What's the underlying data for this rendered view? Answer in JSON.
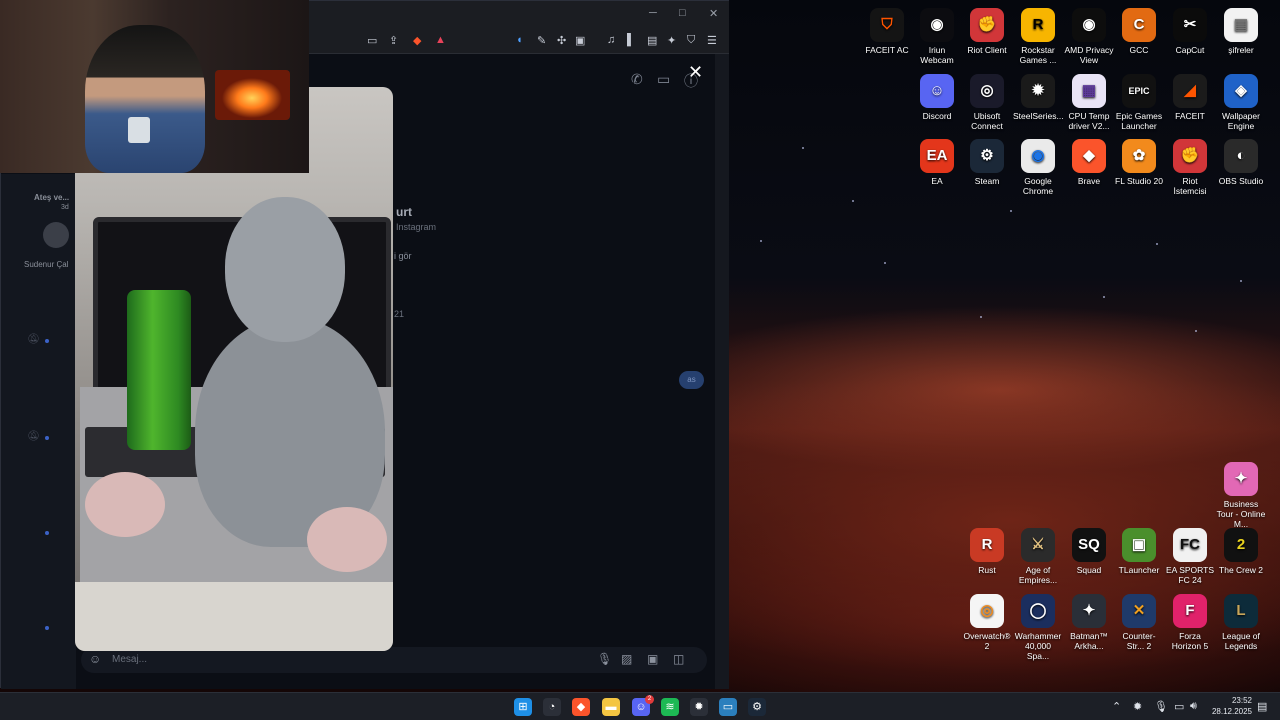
{
  "desktop": {
    "icons": [
      {
        "label": "FACEIT AC",
        "glyph": "⛉",
        "color": "#141414",
        "fg": "#ff5500"
      },
      {
        "label": "Iriun Webcam",
        "glyph": "◉",
        "color": "#0c0c10",
        "fg": "#ffffff"
      },
      {
        "label": "Riot Client",
        "glyph": "✊",
        "color": "#d13639",
        "fg": "#ffffff"
      },
      {
        "label": "Rockstar Games ...",
        "glyph": "R",
        "color": "#f7b500",
        "fg": "#000000"
      },
      {
        "label": "AMD Privacy View",
        "glyph": "◉",
        "color": "#0d0d0d",
        "fg": "#ffffff"
      },
      {
        "label": "GCC",
        "glyph": "C",
        "color": "#e26a12",
        "fg": "#ffffff"
      },
      {
        "label": "CapCut",
        "glyph": "✂",
        "color": "#0b0b0b",
        "fg": "#ffffff"
      },
      {
        "label": "şifreler",
        "glyph": "▤",
        "color": "#f2f2f2",
        "fg": "#777777"
      },
      {
        "label": "Discord",
        "glyph": "☺",
        "color": "#5865f2",
        "fg": "#ffffff"
      },
      {
        "label": "Ubisoft Connect",
        "glyph": "◎",
        "color": "#1a1a2a",
        "fg": "#ffffff"
      },
      {
        "label": "SteelSeries...",
        "glyph": "✹",
        "color": "#1a1a1a",
        "fg": "#ffffff"
      },
      {
        "label": "CPU Temp driver V2...",
        "glyph": "▦",
        "color": "#e9e4f6",
        "fg": "#5d3a9b"
      },
      {
        "label": "Epic Games Launcher",
        "glyph": "EPIC",
        "color": "#111111",
        "fg": "#ffffff"
      },
      {
        "label": "FACEIT",
        "glyph": "◢",
        "color": "#1b1b1b",
        "fg": "#ff5500"
      },
      {
        "label": "Wallpaper Engine",
        "glyph": "◈",
        "color": "#1f62c8",
        "fg": "#ffffff"
      },
      {
        "label": "EA",
        "glyph": "EA",
        "color": "#e3361b",
        "fg": "#ffffff"
      },
      {
        "label": "Steam",
        "glyph": "⚙",
        "color": "#1b2838",
        "fg": "#ffffff"
      },
      {
        "label": "Google Chrome",
        "glyph": "◉",
        "color": "#eaeaea",
        "fg": "#1a73e8"
      },
      {
        "label": "Brave",
        "glyph": "◆",
        "color": "#fb542b",
        "fg": "#ffffff"
      },
      {
        "label": "FL Studio 20",
        "glyph": "✿",
        "color": "#f28a1c",
        "fg": "#ffffff"
      },
      {
        "label": "Riot İstemcisi",
        "glyph": "✊",
        "color": "#d13639",
        "fg": "#ffffff"
      },
      {
        "label": "OBS Studio",
        "glyph": "◐",
        "color": "#2a2a2a",
        "fg": "#ffffff"
      },
      {
        "label": "Business Tour - Online M...",
        "glyph": "✦",
        "color": "#e268b5",
        "fg": "#ffffff"
      },
      {
        "label": "Rust",
        "glyph": "R",
        "color": "#c93a24",
        "fg": "#ffffff"
      },
      {
        "label": "Age of Empires...",
        "glyph": "⚔",
        "color": "#2b2b2b",
        "fg": "#e0c080"
      },
      {
        "label": "Squad",
        "glyph": "SQ",
        "color": "#111111",
        "fg": "#ffffff"
      },
      {
        "label": "TLauncher",
        "glyph": "▣",
        "color": "#4a8f2c",
        "fg": "#ffffff"
      },
      {
        "label": "EA SPORTS FC 24",
        "glyph": "FC",
        "color": "#f1f1f1",
        "fg": "#111111"
      },
      {
        "label": "The Crew 2",
        "glyph": "2",
        "color": "#111111",
        "fg": "#e9d21e"
      },
      {
        "label": "Overwatch® 2",
        "glyph": "◎",
        "color": "#f5f5f5",
        "fg": "#f08b1e"
      },
      {
        "label": "Warhammer 40,000 Spa...",
        "glyph": "◯",
        "color": "#1b2e5e",
        "fg": "#ffffff"
      },
      {
        "label": "Batman™ Arkha...",
        "glyph": "✦",
        "color": "#2a2f38",
        "fg": "#ffffff"
      },
      {
        "label": "Counter-Str... 2",
        "glyph": "✕",
        "color": "#1f3a6a",
        "fg": "#f0a020"
      },
      {
        "label": "Forza Horizon 5",
        "glyph": "F",
        "color": "#e0226a",
        "fg": "#ffffff"
      },
      {
        "label": "League of Legends",
        "glyph": "L",
        "color": "#0d2b3a",
        "fg": "#c8a65a"
      }
    ]
  },
  "chat": {
    "sidebar": {
      "top_name": "Ateş ve...",
      "side_time": "3d",
      "second_name": "Sudenur Çal"
    },
    "profile": {
      "name_partial": "urt",
      "source": "Instagram",
      "button_partial": "i gör",
      "time_partial": "21"
    },
    "my_bubble": "as",
    "composer_placeholder": "Mesaj...",
    "header_icons": [
      "phone-icon",
      "video-icon",
      "info-icon"
    ]
  },
  "viewer": {
    "close_glyph": "✕"
  },
  "taskbar": {
    "apps": [
      {
        "name": "windows-start",
        "glyph": "⊞",
        "color": "#1e8fe6"
      },
      {
        "name": "steelseries-gg",
        "glyph": "◔",
        "color": "#2b2f38"
      },
      {
        "name": "brave",
        "glyph": "◆",
        "color": "#fb542b"
      },
      {
        "name": "file-explorer",
        "glyph": "▬",
        "color": "#f4c542"
      },
      {
        "name": "discord",
        "glyph": "☺",
        "color": "#5865f2"
      },
      {
        "name": "spotify",
        "glyph": "≋",
        "color": "#1db954"
      },
      {
        "name": "steelseries",
        "glyph": "✹",
        "color": "#2b2f38"
      },
      {
        "name": "remote-desktop",
        "glyph": "▭",
        "color": "#2b7fbd"
      },
      {
        "name": "steam",
        "glyph": "⚙",
        "color": "#1b2838"
      }
    ],
    "discord_badge": "2",
    "time": "23:52",
    "date": "28.12.2025"
  }
}
